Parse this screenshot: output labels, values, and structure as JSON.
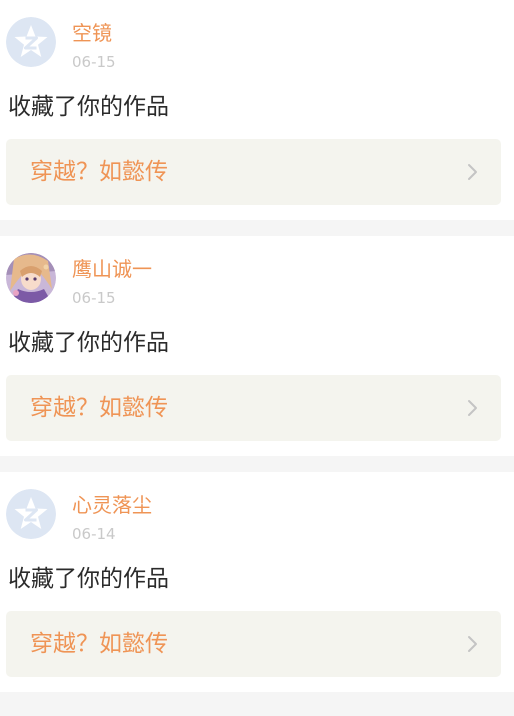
{
  "feed": {
    "items": [
      {
        "avatar": "default-z-avatar",
        "username": "空镜",
        "date": "06-15",
        "action": "收藏了你的作品",
        "work_title": "穿越？如懿传"
      },
      {
        "avatar": "anime-girl-avatar",
        "username": "鹰山诚一",
        "date": "06-15",
        "action": "收藏了你的作品",
        "work_title": "穿越？如懿传"
      },
      {
        "avatar": "default-z-avatar",
        "username": "心灵落尘",
        "date": "06-14",
        "action": "收藏了你的作品",
        "work_title": "穿越？如懿传"
      }
    ]
  },
  "colors": {
    "accent": "#ef9455",
    "date": "#c9c9c9",
    "card_link_bg": "#f4f4ee",
    "page_bg": "#f5f5f5",
    "text": "#2b2b2b",
    "default_avatar_bg": "#dde6f3"
  },
  "icons": {
    "chevron": "chevron-right-icon",
    "default_avatar": "default-z-avatar"
  }
}
